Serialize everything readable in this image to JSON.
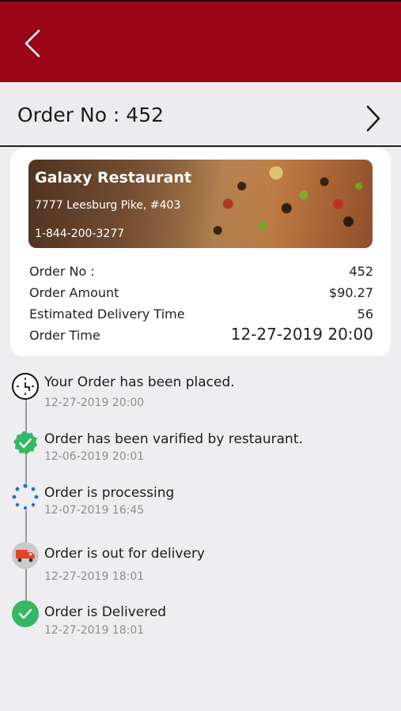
{
  "header": {
    "back_icon": "chevron-left-icon",
    "order_title": "Order No : 452",
    "next_icon": "chevron-right-icon",
    "accent_color": "#9a0617"
  },
  "restaurant": {
    "name": "Galaxy Restaurant",
    "address": "7777 Leesburg Pike, #403",
    "phone": "1-844-200-3277"
  },
  "details": [
    {
      "label": "Order No :",
      "value": "452"
    },
    {
      "label": "Order Amount",
      "value": "$90.27"
    },
    {
      "label": "Estimated Delivery Time",
      "value": "56"
    },
    {
      "label": "Order Time",
      "value": "12-27-2019 20:00"
    }
  ],
  "timeline": [
    {
      "title": "Your Order has been placed.",
      "time": "12-27-2019 20:00",
      "icon": "clock-icon"
    },
    {
      "title": "Order has been varified by restaurant.",
      "time": "12-06-2019 20:01",
      "icon": "verified-badge-icon"
    },
    {
      "title": "Order is processing",
      "time": "12-07-2019 16:45",
      "icon": "loading-spinner-icon"
    },
    {
      "title": "Order is out for delivery",
      "time": "12-27-2019 18:01",
      "icon": "delivery-truck-icon"
    },
    {
      "title": "Order is Delivered",
      "time": "12-27-2019 18:01",
      "icon": "check-circle-icon"
    }
  ]
}
